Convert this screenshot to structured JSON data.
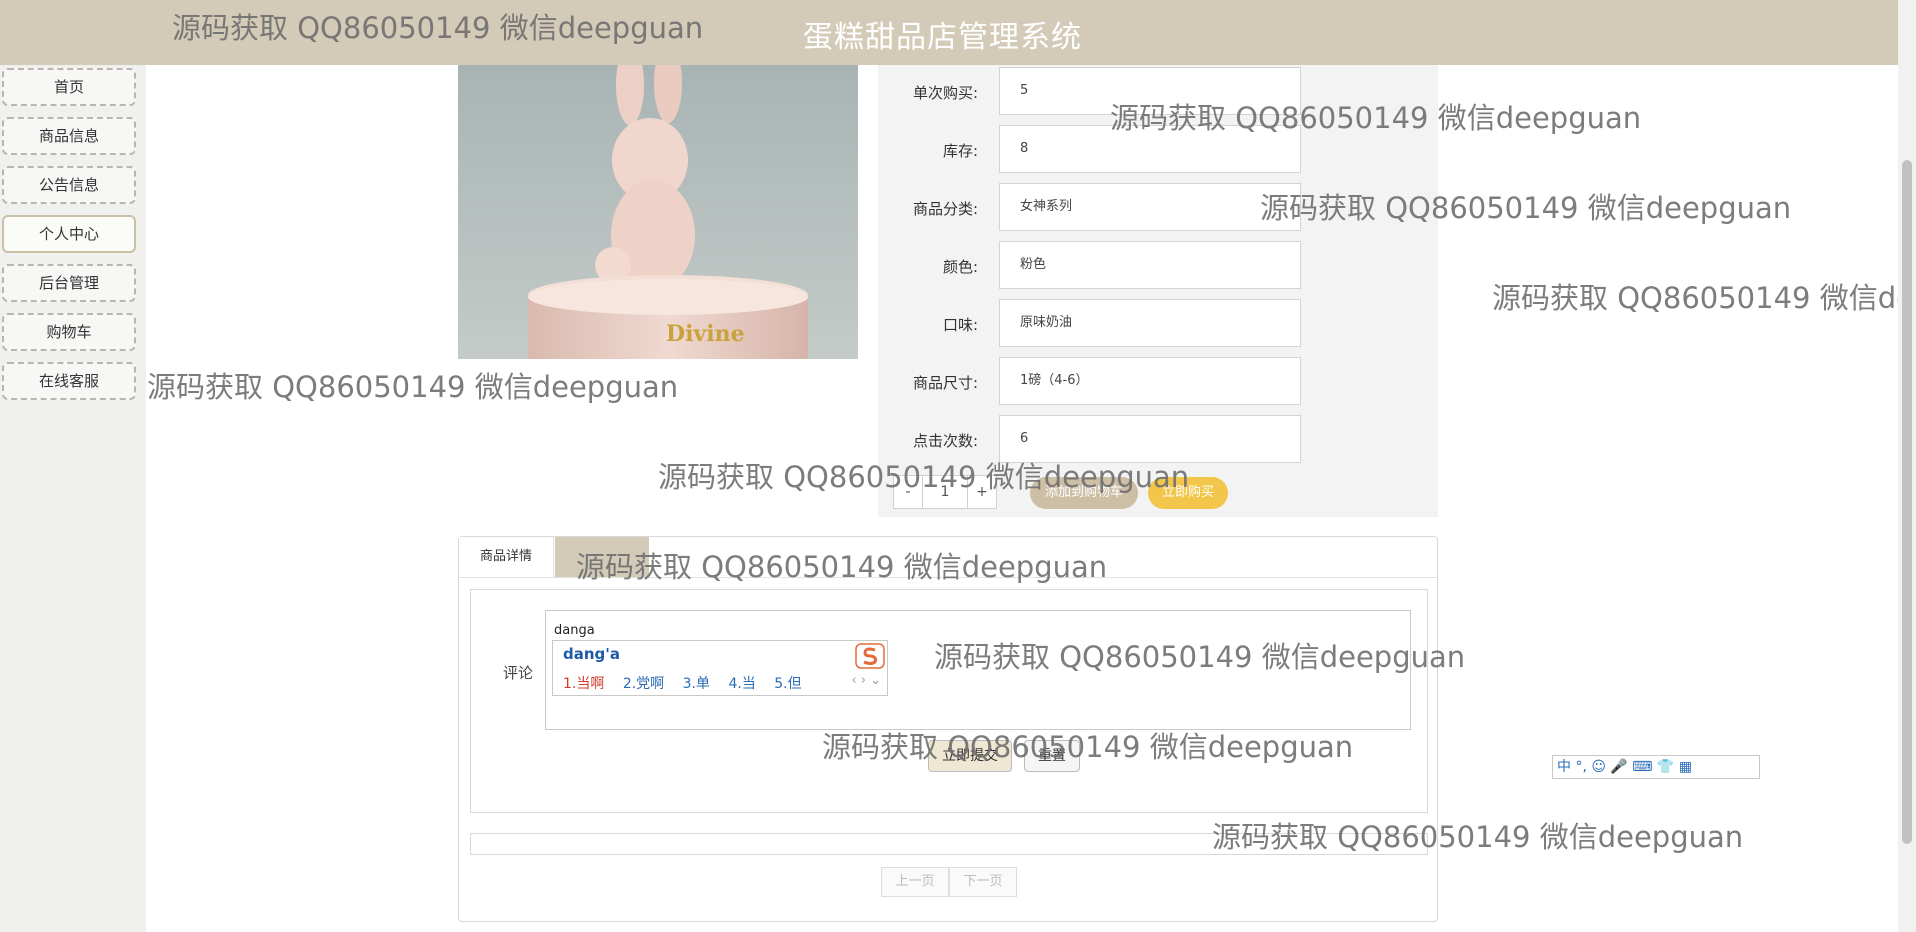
{
  "header": {
    "title": "蛋糕甜品店管理系统"
  },
  "sidebar": {
    "items": [
      {
        "label": "首页"
      },
      {
        "label": "商品信息"
      },
      {
        "label": "公告信息"
      },
      {
        "label": "个人中心",
        "active": true
      },
      {
        "label": "后台管理"
      },
      {
        "label": "购物车"
      },
      {
        "label": "在线客服"
      }
    ]
  },
  "product": {
    "image_text": "Divine",
    "fields": [
      {
        "label": "单次购买:",
        "value": "5"
      },
      {
        "label": "库存:",
        "value": "8"
      },
      {
        "label": "商品分类:",
        "value": "女神系列"
      },
      {
        "label": "颜色:",
        "value": "粉色"
      },
      {
        "label": "口味:",
        "value": "原味奶油"
      },
      {
        "label": "商品尺寸:",
        "value": "1磅（4-6）"
      },
      {
        "label": "点击次数:",
        "value": "6"
      }
    ],
    "quantity": {
      "minus": "-",
      "value": "1",
      "plus": "+"
    },
    "add_to_cart": "添加到购物车",
    "buy_now": "立即购买"
  },
  "detail": {
    "tabs": [
      "商品详情"
    ],
    "comment_label": "评论",
    "comment_value": "danga",
    "ime": {
      "composition": "dang'a",
      "candidates": [
        "1.当啊",
        "2.党啊",
        "3.单",
        "4.当",
        "5.但"
      ]
    },
    "submit": "立即提交",
    "reset": "重置",
    "prev": "上一页",
    "next": "下一页"
  },
  "ime_toolbar": "中 °, ☺ 🎤 ⌨ 👕 ▦",
  "watermark": "源码获取 QQ86050149 微信deepguan",
  "colors": {
    "header": "#d3cab7",
    "buy": "#f2c64a",
    "cart": "#cdbfa6",
    "ime_blue": "#2b6cb7",
    "ime_red": "#d23b2d"
  }
}
